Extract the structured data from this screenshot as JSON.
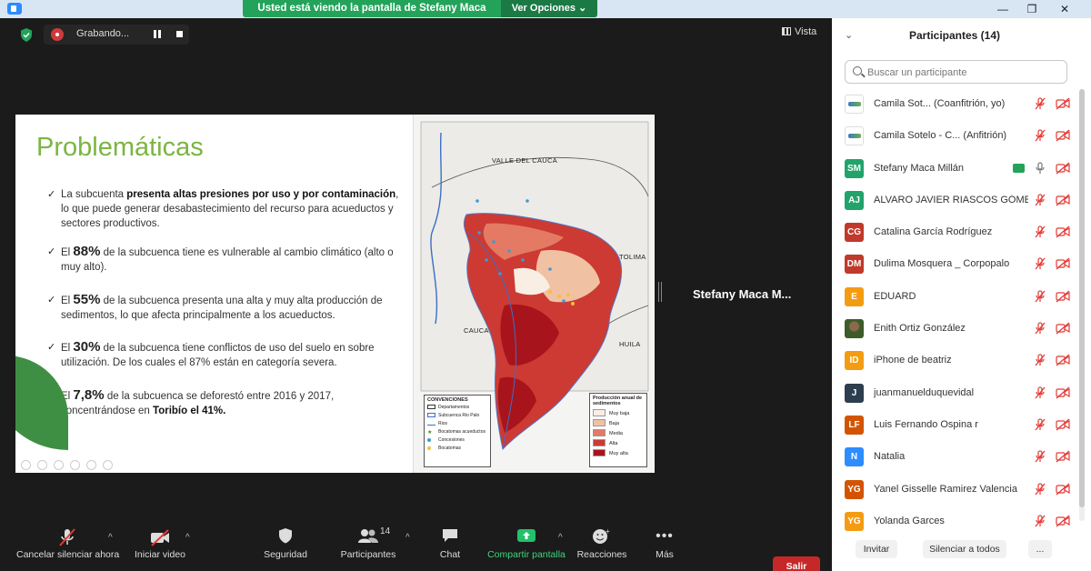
{
  "titlebar": {
    "share_message": "Usted está viendo la pantalla de Stefany Maca Millán",
    "view_options": "Ver Opciones",
    "minimize": "—",
    "restore": "❐",
    "close": "✕"
  },
  "meeting": {
    "recording_label": "Grabando...",
    "view_label": "Vista",
    "speaker_name": "Stefany Maca M..."
  },
  "slide": {
    "title": "Problemáticas",
    "bullets": [
      {
        "pre": "La subcuenta ",
        "bold": "presenta altas presiones por uso y por contaminación",
        "post": ", lo que puede generar desabastecimiento del recurso para acueductos y sectores productivos."
      },
      {
        "pre": "El ",
        "big": "88%",
        "post": " de la subcuenca tiene es vulnerable al cambio climático (alto o muy alto)."
      },
      {
        "pre": "El ",
        "big": "55%",
        "post": " de la subcuenca presenta una alta y muy alta producción de sedimentos, lo que afecta principalmente a los acueductos."
      },
      {
        "pre": "El ",
        "big": "30%",
        "post": " de la subcuenca tiene conflictos de uso del suelo en sobre utilización. De los cuales el 87% están en categoría severa."
      },
      {
        "pre": "El ",
        "big": "7,8%",
        "post": " de la subcuenca se deforestó entre 2016 y 2017, concentrándose en ",
        "bold2": "Toribío el 41%."
      }
    ],
    "map": {
      "labels": [
        "VALLE DEL CAUCA",
        "TOLIMA",
        "CAUCA",
        "HUILA"
      ],
      "legend_left": {
        "title": "CONVENCIONES",
        "items": [
          "Departamentos",
          "Subcuenca Rio Palo",
          "Rios",
          "Bocatomas acueductos",
          "Concesiones",
          "Bocatomas"
        ]
      },
      "legend_right": {
        "title": "Producción anual de sedimentos",
        "items": [
          {
            "label": "Muy baja",
            "color": "#f9eee4"
          },
          {
            "label": "Baja",
            "color": "#f1c1a3"
          },
          {
            "label": "Media",
            "color": "#e47a63"
          },
          {
            "label": "Alta",
            "color": "#cc3a33"
          },
          {
            "label": "Muy alta",
            "color": "#a8141b"
          }
        ]
      }
    }
  },
  "toolbar": {
    "mute": "Cancelar silenciar ahora",
    "video": "Iniciar video",
    "security": "Seguridad",
    "participants": "Participantes",
    "participants_count": "14",
    "chat": "Chat",
    "share": "Compartir pantalla",
    "reactions": "Reacciones",
    "more": "Más",
    "leave": "Salir",
    "caret": "^"
  },
  "panel": {
    "title": "Participantes (14)",
    "search_placeholder": "Buscar un participante",
    "participants": [
      {
        "initials": "",
        "name": "Camila Sot...  (Coanfitrión, yo)",
        "color": "",
        "avatar": "logo",
        "mic": "muted",
        "cam": "off"
      },
      {
        "initials": "",
        "name": "Camila Sotelo - C...  (Anfitrión)",
        "color": "",
        "avatar": "logo",
        "mic": "muted",
        "cam": "off"
      },
      {
        "initials": "SM",
        "name": "Stefany Maca Millán",
        "color": "#22a36b",
        "avatar": "initials",
        "mic": "on",
        "cam": "off"
      },
      {
        "initials": "AJ",
        "name": "ALVARO JAVIER RIASCOS GÓMEZ",
        "color": "#22a36b",
        "avatar": "initials",
        "mic": "muted",
        "cam": "off"
      },
      {
        "initials": "CG",
        "name": "Catalina García Rodríguez",
        "color": "#c0392b",
        "avatar": "initials",
        "mic": "muted",
        "cam": "off"
      },
      {
        "initials": "DM",
        "name": "Dulima Mosquera _ Corpopalo",
        "color": "#c0392b",
        "avatar": "initials",
        "mic": "muted",
        "cam": "off"
      },
      {
        "initials": "E",
        "name": "EDUARD",
        "color": "#f39c12",
        "avatar": "initials",
        "mic": "muted",
        "cam": "off"
      },
      {
        "initials": "",
        "name": "Enith Ortiz González",
        "color": "",
        "avatar": "photo",
        "mic": "muted",
        "cam": "off"
      },
      {
        "initials": "ID",
        "name": "iPhone de beatriz",
        "color": "#f39c12",
        "avatar": "initials",
        "mic": "muted",
        "cam": "off"
      },
      {
        "initials": "J",
        "name": "juanmanuelduquevidal",
        "color": "#2c3e50",
        "avatar": "initials",
        "mic": "muted",
        "cam": "off"
      },
      {
        "initials": "LF",
        "name": "Luis Fernando Ospina r",
        "color": "#d35400",
        "avatar": "initials",
        "mic": "muted",
        "cam": "off"
      },
      {
        "initials": "N",
        "name": "Natalia",
        "color": "#2d8cff",
        "avatar": "initials",
        "mic": "muted",
        "cam": "off"
      },
      {
        "initials": "YG",
        "name": "Yanel Gisselle Ramirez Valencia",
        "color": "#d35400",
        "avatar": "initials",
        "mic": "muted",
        "cam": "off"
      },
      {
        "initials": "YG",
        "name": "Yolanda Garces",
        "color": "#f39c12",
        "avatar": "initials",
        "mic": "muted",
        "cam": "off"
      }
    ],
    "invite": "Invitar",
    "mute_all": "Silenciar a todos",
    "more": "..."
  }
}
